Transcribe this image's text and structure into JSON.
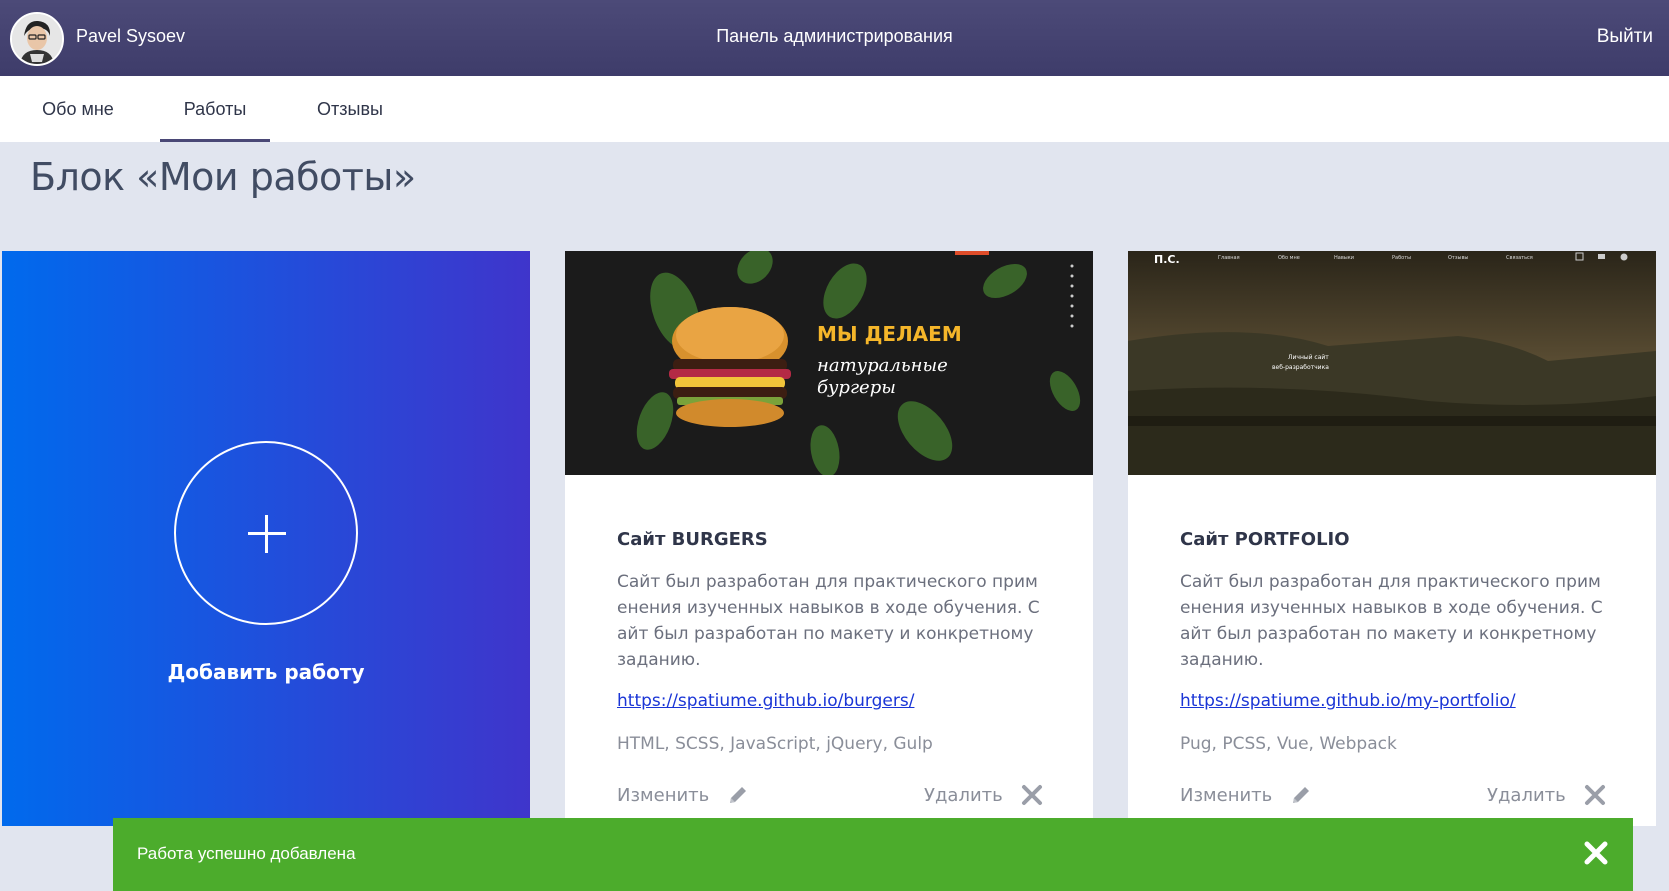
{
  "header": {
    "user_name": "Pavel Sysoev",
    "title": "Панель администрирования",
    "logout_label": "Выйти"
  },
  "tabs": [
    {
      "label": "Обо мне",
      "active": false
    },
    {
      "label": "Работы",
      "active": true
    },
    {
      "label": "Отзывы",
      "active": false
    }
  ],
  "page_title": "Блок «Мои работы»",
  "add_card": {
    "label": "Добавить работу",
    "gradient_from": "#006aed",
    "gradient_to": "#3f35cb"
  },
  "works": [
    {
      "title": "Сайт BURGERS",
      "description": "Сайт был разработан для практического применения изученных навыков в ходе обучения. Сайт был разработан по макету и конкретному заданию.",
      "link": "https://spatiume.github.io/burgers/",
      "tags": "HTML, SCSS, JavaScript, jQuery, Gulp",
      "edit_label": "Изменить",
      "delete_label": "Удалить",
      "thumb": {
        "headline": "МЫ ДЕЛАЕМ",
        "subline1": "натуральные",
        "subline2": "бургеры"
      }
    },
    {
      "title": "Сайт PORTFOLIO",
      "description": "Сайт был разработан для практического применения изученных навыков в ходе обучения. Сайт был разработан по макету и конкретному заданию.",
      "link": "https://spatiume.github.io/my-portfolio/",
      "tags": "Pug, PCSS, Vue, Webpack",
      "edit_label": "Изменить",
      "delete_label": "Удалить",
      "thumb": {
        "logo": "П.С.",
        "nav": [
          "Главная",
          "Обо мне",
          "Навыки",
          "Работы",
          "Отзывы",
          "Связаться"
        ],
        "caption1": "Личный сайт",
        "caption2": "веб-разработчика"
      }
    }
  ],
  "toast": {
    "text": "Работа успешно добавлена",
    "color": "#4cac2c"
  },
  "colors": {
    "header": "#4c4a78",
    "background": "#e1e5ef",
    "link": "#1a35d6"
  }
}
